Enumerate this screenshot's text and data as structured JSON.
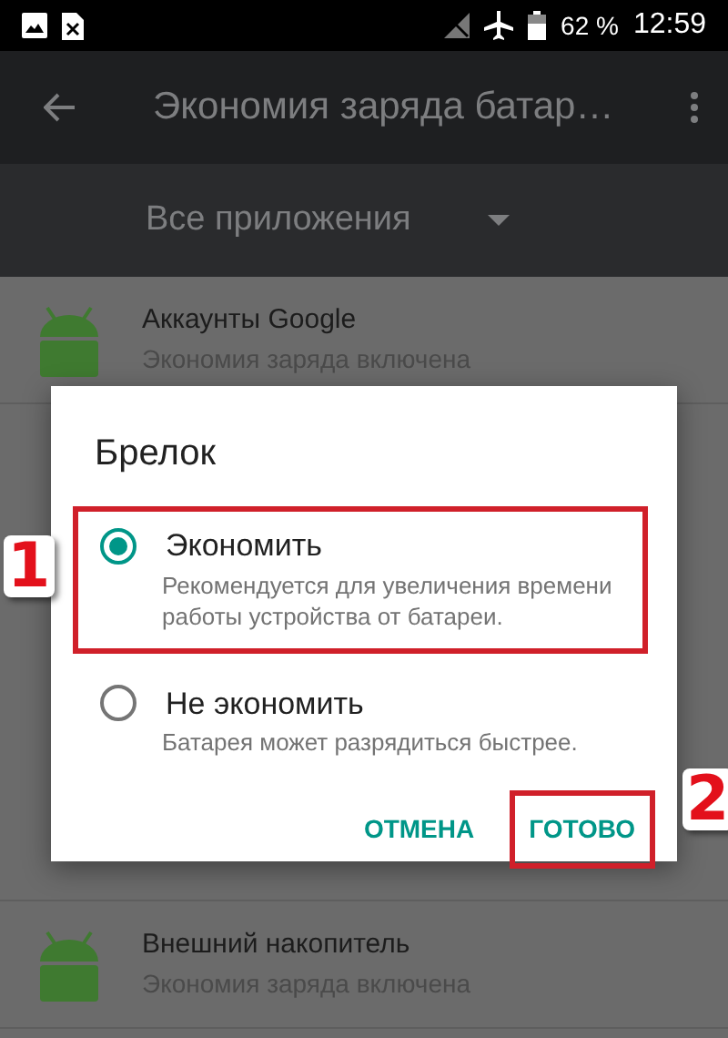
{
  "status_bar": {
    "battery": "62 %",
    "time": "12:59"
  },
  "toolbar": {
    "title": "Экономия заряда батар…"
  },
  "filter": {
    "value": "Все приложения"
  },
  "apps": [
    {
      "name": "Аккаунты Google",
      "status": "Экономия заряда включена"
    },
    {
      "name": "Внешний накопитель",
      "status": "Экономия заряда включена"
    }
  ],
  "dialog": {
    "title": "Брелок",
    "options": [
      {
        "label": "Экономить",
        "description": "Рекомендуется для увеличения времени работы устройства от батареи.",
        "selected": true,
        "annotation": "1"
      },
      {
        "label": "Не экономить",
        "description": "Батарея может разрядиться быстрее.",
        "selected": false
      }
    ],
    "buttons": [
      {
        "label": "ОТМЕНА"
      },
      {
        "label": "ГОТОВО",
        "annotation": "2"
      }
    ]
  }
}
